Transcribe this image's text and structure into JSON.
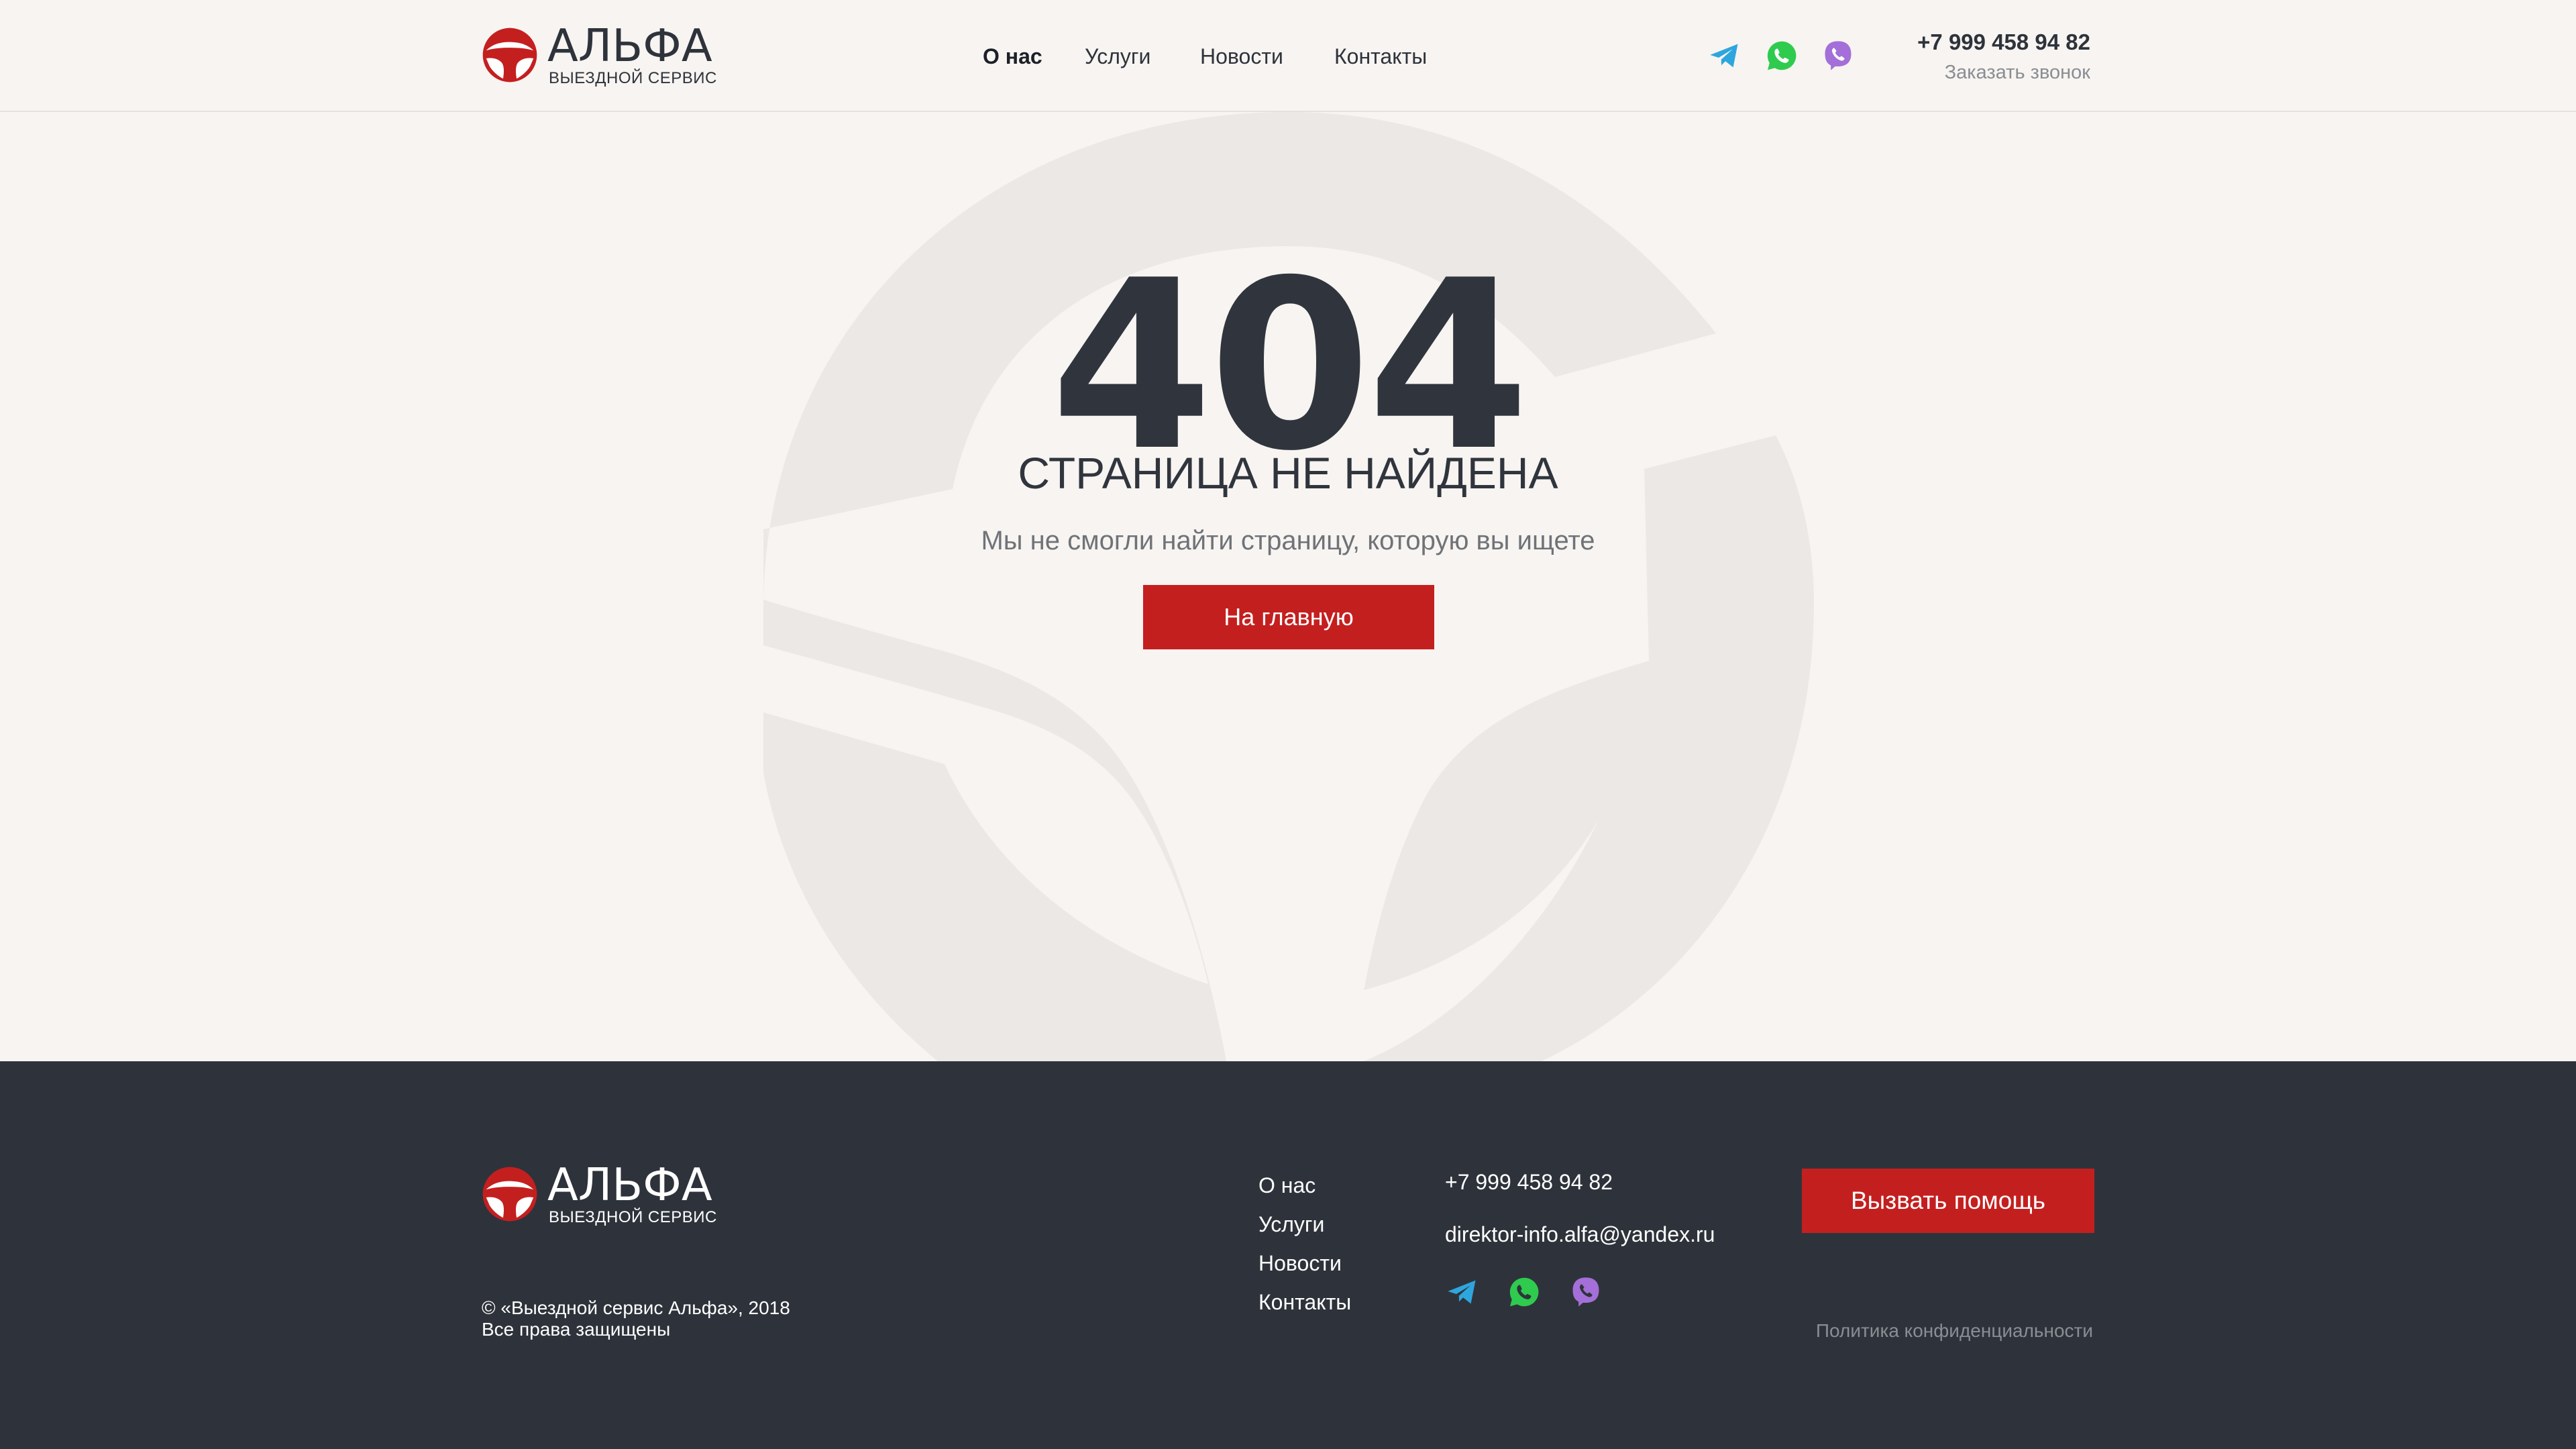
{
  "brand": {
    "name": "АЛЬФА",
    "tagline": "ВЫЕЗДНОЙ СЕРВИС",
    "accent_color": "#c41f1f",
    "dark_color": "#2e333b",
    "background_color": "#f7f4f1"
  },
  "header": {
    "nav": [
      {
        "label": "О нас",
        "active": true
      },
      {
        "label": "Услуги",
        "active": false
      },
      {
        "label": "Новости",
        "active": false
      },
      {
        "label": "Контакты",
        "active": false
      }
    ],
    "social": [
      "telegram-icon",
      "whatsapp-icon",
      "viber-icon"
    ],
    "phone": "+7 999 458 94 82",
    "callback": "Заказать звонок"
  },
  "main": {
    "code": "404",
    "title": "СТРАНИЦА НЕ НАЙДЕНА",
    "subtitle": "Мы не смогли найти страницу, которую вы ищете",
    "button": "На главную"
  },
  "footer": {
    "copyright_line1": "© «Выездной сервис Альфа», 2018",
    "copyright_line2": "Все права защищены",
    "nav": [
      {
        "label": "О нас"
      },
      {
        "label": "Услуги"
      },
      {
        "label": "Новости"
      },
      {
        "label": "Контакты"
      }
    ],
    "phone": "+7 999 458 94 82",
    "email": "direktor-info.alfa@yandex.ru",
    "social": [
      "telegram-icon",
      "whatsapp-icon",
      "viber-icon"
    ],
    "button": "Вызвать помощь",
    "privacy": "Политика конфиденциальности"
  },
  "social_colors": {
    "telegram": "#2ea6dd",
    "whatsapp": "#2fcb4e",
    "viber": "#a46fd8"
  }
}
